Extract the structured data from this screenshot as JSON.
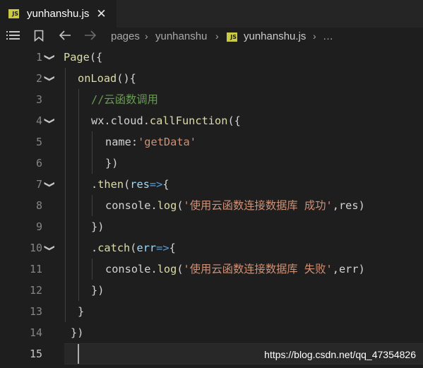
{
  "tab": {
    "badge": "JS",
    "label": "yunhanshu.js",
    "close": "✕"
  },
  "breadcrumb": {
    "items": [
      "pages",
      "yunhanshu",
      "yunhanshu.js",
      "…"
    ],
    "file_badge": "JS"
  },
  "lines": [
    {
      "n": "1"
    },
    {
      "n": "2"
    },
    {
      "n": "3"
    },
    {
      "n": "4"
    },
    {
      "n": "5"
    },
    {
      "n": "6"
    },
    {
      "n": "7"
    },
    {
      "n": "8"
    },
    {
      "n": "9"
    },
    {
      "n": "10"
    },
    {
      "n": "11"
    },
    {
      "n": "12"
    },
    {
      "n": "13"
    },
    {
      "n": "14"
    },
    {
      "n": "15"
    }
  ],
  "code": {
    "l1": [
      "Page",
      "({"
    ],
    "l2": [
      "onLoad",
      "(){"
    ],
    "l3": [
      "//云函数调用"
    ],
    "l4": [
      "wx",
      ".",
      "cloud",
      ".",
      "callFunction",
      "({"
    ],
    "l5": [
      "name",
      ":",
      "'getData'"
    ],
    "l6": [
      "})"
    ],
    "l7": [
      ".",
      "then",
      "(",
      "res",
      "=>",
      "{"
    ],
    "l8": [
      "console",
      ".",
      "log",
      "(",
      "'使用云函数连接数据库 成功'",
      ",",
      "res",
      ")"
    ],
    "l9": [
      "})"
    ],
    "l10": [
      ".",
      "catch",
      "(",
      "err",
      "=>",
      "{"
    ],
    "l11": [
      "console",
      ".",
      "log",
      "(",
      "'使用云函数连接数据库 失败'",
      ",",
      "err",
      ")"
    ],
    "l12": [
      "})"
    ],
    "l13": [
      "}"
    ],
    "l14": [
      "})"
    ]
  },
  "watermark": "https://blog.csdn.net/qq_47354826",
  "colors": {
    "editor_bg": "#1e1e1e",
    "string": "#ce9178",
    "function": "#dcdcaa",
    "comment": "#6a9955"
  }
}
